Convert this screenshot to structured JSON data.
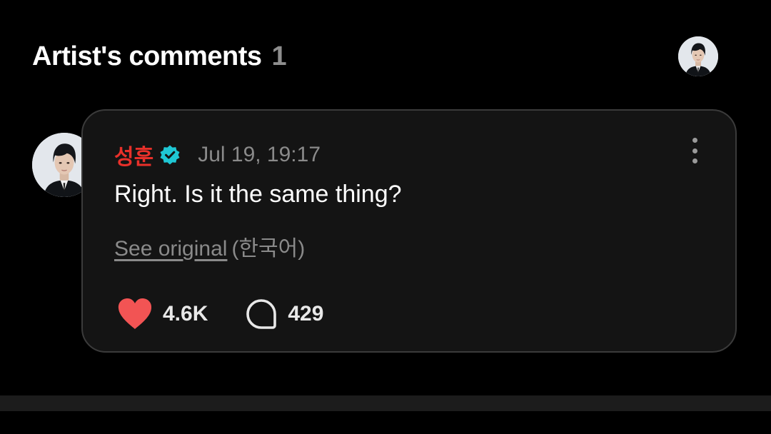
{
  "header": {
    "title": "Artist's comments",
    "count": "1"
  },
  "comment": {
    "author": "성훈",
    "author_color": "#e8302a",
    "verified_badge_color": "#1fc7d4",
    "timestamp": "Jul 19, 19:17",
    "text": "Right. Is it the same thing?",
    "see_original_label": "See original",
    "original_language": "(한국어)",
    "likes": "4.6K",
    "replies": "429",
    "like_color": "#f25454",
    "icons": {
      "like": "heart-icon",
      "reply": "speech-bubble-icon",
      "more": "more-vertical-icon",
      "verified": "verified-check-icon"
    }
  }
}
